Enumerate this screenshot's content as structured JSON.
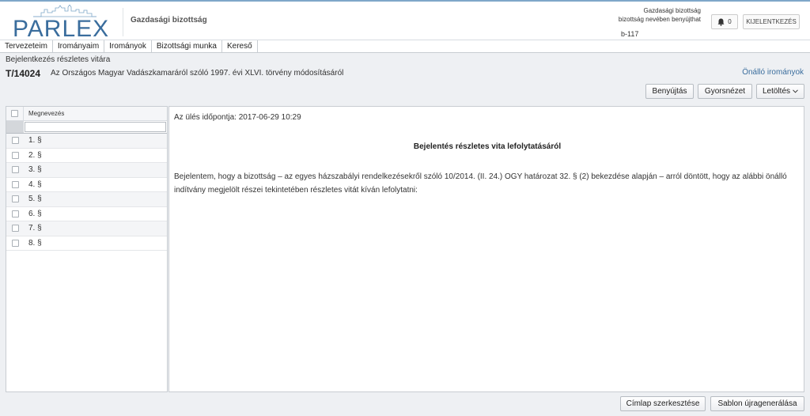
{
  "header": {
    "logo_text": "PARLEX",
    "committee_name": "Gazdasági bizottság",
    "user_line1": "Gazdasági bizottság",
    "user_line2": "bizottság nevében benyújthat",
    "user_id": "b-117",
    "notification_count": "0",
    "logout_label": "KIJELENTKEZÉS"
  },
  "menu": {
    "items": [
      "Tervezeteim",
      "Irományaim",
      "Irományok",
      "Bizottsági munka",
      "Kereső"
    ]
  },
  "page": {
    "breadcrumb": "Bejelentkezés részletes vitára",
    "doc_id": "T/14024",
    "doc_title": "Az Országos Magyar Vadászkamaráról szóló 1997. évi XLVI. törvény módosításáról",
    "doc_type": "Önálló irományok"
  },
  "toolbar": {
    "submit_label": "Benyújtás",
    "preview_label": "Gyorsnézet",
    "download_label": "Letöltés"
  },
  "left_panel": {
    "column_header": "Megnevezés",
    "rows": [
      "1. §",
      "2. §",
      "3. §",
      "4. §",
      "5. §",
      "6. §",
      "7. §",
      "8. §"
    ]
  },
  "document": {
    "meeting_time": "Az ülés időpontja: 2017-06-29 10:29",
    "heading": "Bejelentés részletes vita lefolytatásáról",
    "body": "Bejelentem, hogy a bizottság – az egyes házszabályi rendelkezésekről szóló 10/2014. (II. 24.) OGY határozat 32. § (2) bekezdése alapján – arról döntött, hogy az alábbi önálló indítvány megjelölt részei tekintetében részletes vitát kíván lefolytatni:"
  },
  "footer": {
    "edit_cover_label": "Címlap szerkesztése",
    "regenerate_label": "Sablon újragenerálása"
  },
  "colors": {
    "brand": "#3a6d9d",
    "accent": "#7fa7c9"
  }
}
